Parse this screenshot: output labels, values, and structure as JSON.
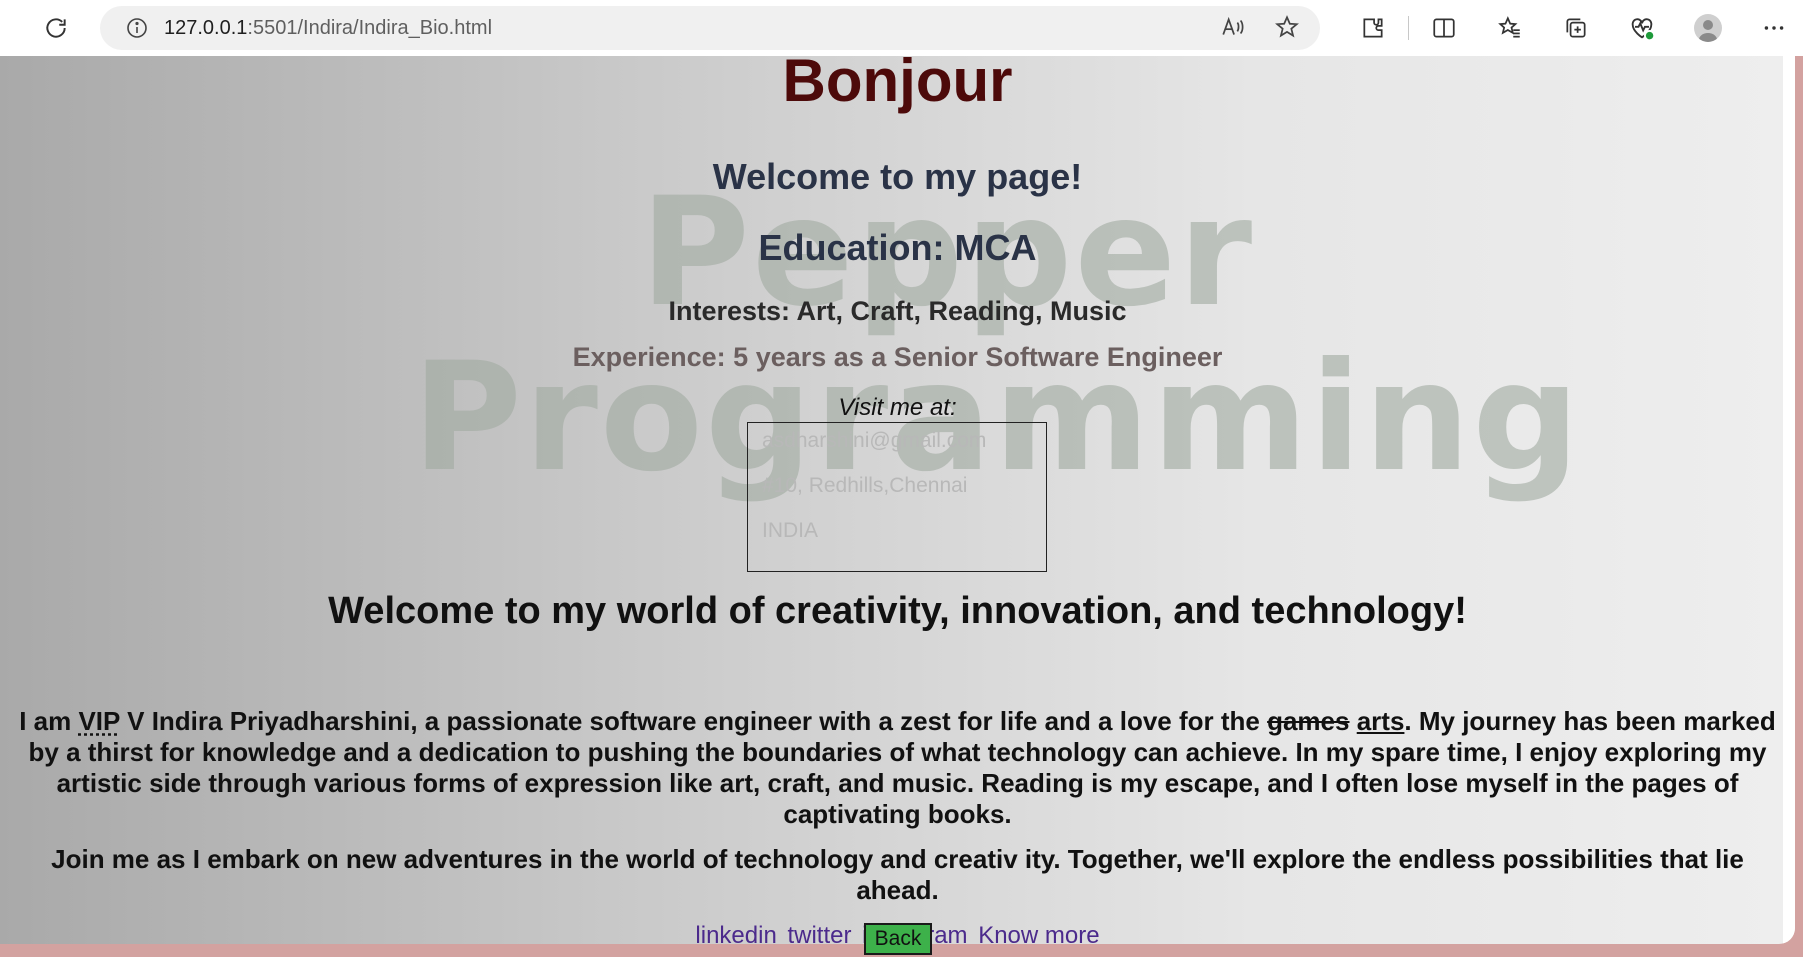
{
  "browser": {
    "url_host": "127.0.0.1",
    "url_rest": ":5501/Indira/Indira_Bio.html",
    "icons": [
      "reload-icon",
      "site-info-icon",
      "read-aloud-icon",
      "favorite-star-icon",
      "extensions-icon",
      "split-screen-icon",
      "favorites-icon",
      "collections-icon",
      "browser-essentials-icon",
      "profile-icon",
      "more-icon"
    ]
  },
  "page": {
    "watermark_line1": "Pepper",
    "watermark_line2": "Programming",
    "title": "Bonjour",
    "welcome": "Welcome to my page!",
    "education": "Education: MCA",
    "interests": "Interests: Art, Craft, Reading, Music",
    "experience": "Experience: 5 years as a Senior Software Engineer",
    "visit_label": "Visit me at:",
    "address": {
      "email": "asdharshini@gmail.com",
      "street": "#10, Redhills,Chennai",
      "country": "INDIA"
    },
    "world_heading": "Welcome to my world of creativity, innovation, and technology!",
    "para1": {
      "prefix": "I am ",
      "abbr": "VIP",
      "middle": " V Indira Priyadharshini, a passionate software engineer with a zest for life and a love for the ",
      "deleted": "games",
      "inserted": "arts",
      "suffix": ". My journey has been marked by a thirst for knowledge and a dedication to pushing the boundaries of what technology can achieve. In my spare time, I enjoy exploring my artistic side through various forms of expression like art, craft, and music. Reading is my escape, and I often lose myself in the pages of captivating books."
    },
    "para2": "Join me as I embark on new adventures in the world of technology and creativ ity. Together, we'll explore the endless possibilities that lie ahead.",
    "links": [
      "linkedin",
      "twitter",
      "instagram",
      "Know more"
    ],
    "back_label": "Back",
    "colors": {
      "title": "#4d0a0a",
      "heading": "#2a3347",
      "link": "#4b2a8c",
      "back_button": "#3db14a"
    }
  }
}
